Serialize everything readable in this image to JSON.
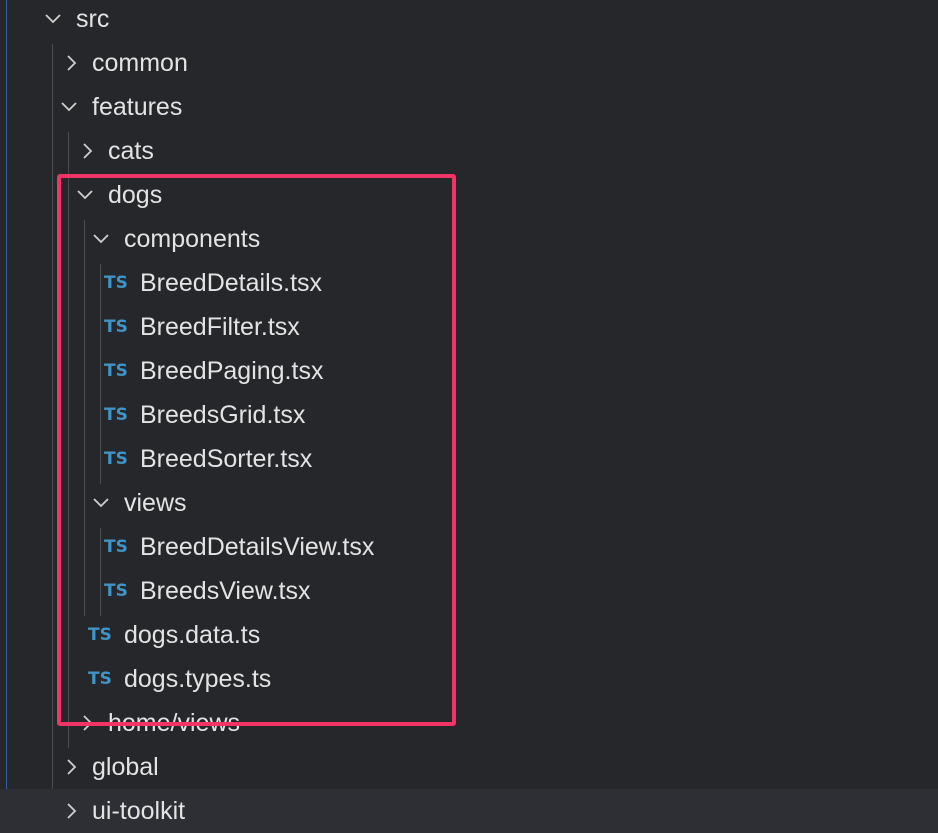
{
  "explorer": {
    "tree": {
      "src": {
        "label": "src"
      },
      "common": {
        "label": "common"
      },
      "features": {
        "label": "features"
      },
      "cats": {
        "label": "cats"
      },
      "dogs": {
        "label": "dogs"
      },
      "components": {
        "label": "components"
      },
      "breed_details": {
        "label": "BreedDetails.tsx",
        "icon": "TS"
      },
      "breed_filter": {
        "label": "BreedFilter.tsx",
        "icon": "TS"
      },
      "breed_paging": {
        "label": "BreedPaging.tsx",
        "icon": "TS"
      },
      "breeds_grid": {
        "label": "BreedsGrid.tsx",
        "icon": "TS"
      },
      "breed_sorter": {
        "label": "BreedSorter.tsx",
        "icon": "TS"
      },
      "views": {
        "label": "views"
      },
      "breed_details_view": {
        "label": "BreedDetailsView.tsx",
        "icon": "TS"
      },
      "breeds_view": {
        "label": "BreedsView.tsx",
        "icon": "TS"
      },
      "dogs_data": {
        "label": "dogs.data.ts",
        "icon": "TS"
      },
      "dogs_types": {
        "label": "dogs.types.ts",
        "icon": "TS"
      },
      "home_views": {
        "label": "home/views"
      },
      "global": {
        "label": "global"
      },
      "ui_toolkit": {
        "label": "ui-toolkit"
      }
    }
  },
  "colors": {
    "background": "#26272b",
    "text": "#e3e3e3",
    "ts_icon": "#3e95c9",
    "highlight_border": "#f23366",
    "hover_row": "#2d2f34",
    "indent_guide": "#4a4c52"
  },
  "icons": {
    "expanded": "chevron-down-icon",
    "collapsed": "chevron-right-icon",
    "file_type": "typescript-icon"
  }
}
